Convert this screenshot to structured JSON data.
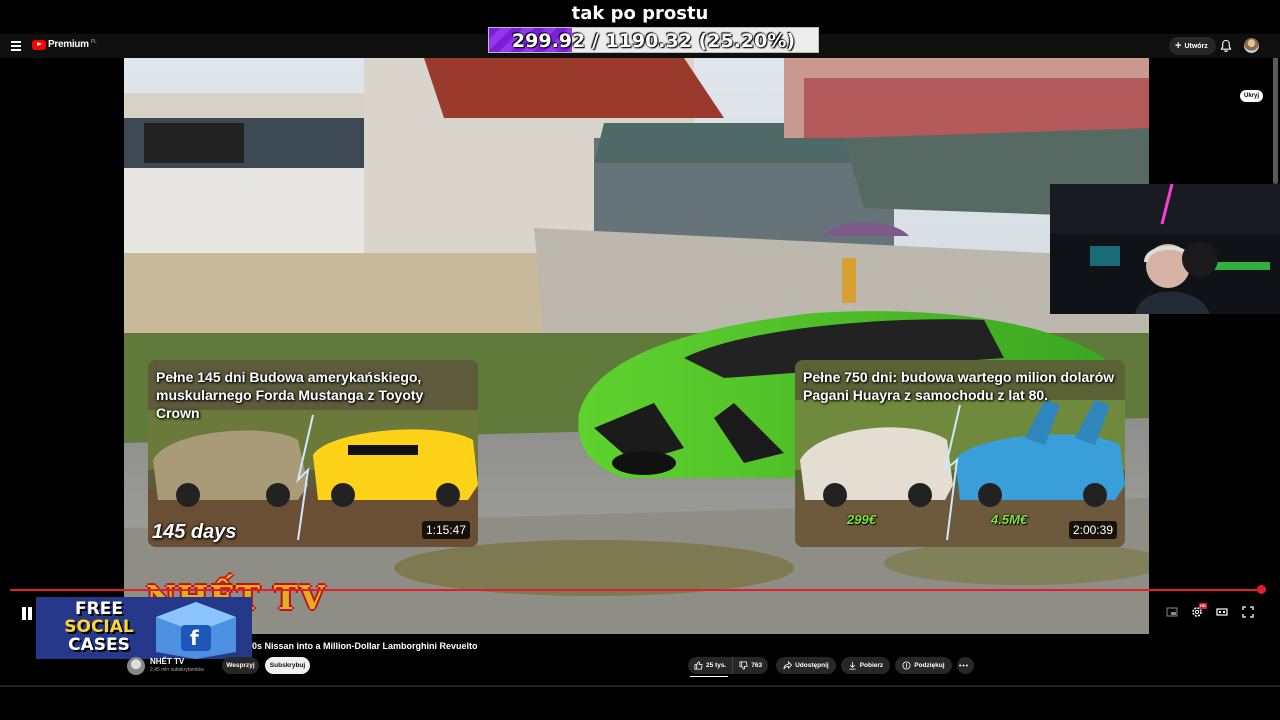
{
  "overlay": {
    "title": "tak po prostu",
    "donation_text": "299.92 / 1190.32 (25.20%)",
    "donation_progress_fraction": 0.252
  },
  "header": {
    "logo_text": "Premium",
    "logo_region": "PL",
    "create_label": "Utwórz"
  },
  "cards": [
    {
      "title": "Pełne 145 dni Budowa amerykańskiego, muskularnego Forda Mustanga z Toyoty Crown",
      "duration": "1:15:47",
      "tag": "145 days"
    },
    {
      "title": "Pełne 750 dni: budowa wartego milion dolarów Pagani Huayra z samochodu z lat 80.",
      "duration": "2:00:39",
      "price_left": "299€",
      "price_right": "4.5M€"
    }
  ],
  "subtitles_badge": "Ukryj",
  "watermark": "NHẾT TV",
  "promo": {
    "line1": "FREE",
    "line2": "SOCIAL",
    "line3": "CASES"
  },
  "player": {
    "progress_fraction": 1.0,
    "hd_label": "HD"
  },
  "video": {
    "title": "0s Nissan into a Million-Dollar Lamborghini Revuelto",
    "channel_name": "NHẾT TV",
    "channel_subs": "2,45 mln subskrybentów",
    "support_label": "Wesprzyj",
    "subscribe_label": "Subskrybuj",
    "likes": "25 tys.",
    "dislikes": "763",
    "share_label": "Udostępnij",
    "download_label": "Pobierz",
    "thanks_label": "Podziękuj"
  },
  "colors": {
    "accent_red": "#e51d2a",
    "donation_purple": "#7a1fd6",
    "background": "#0f0f0f"
  }
}
